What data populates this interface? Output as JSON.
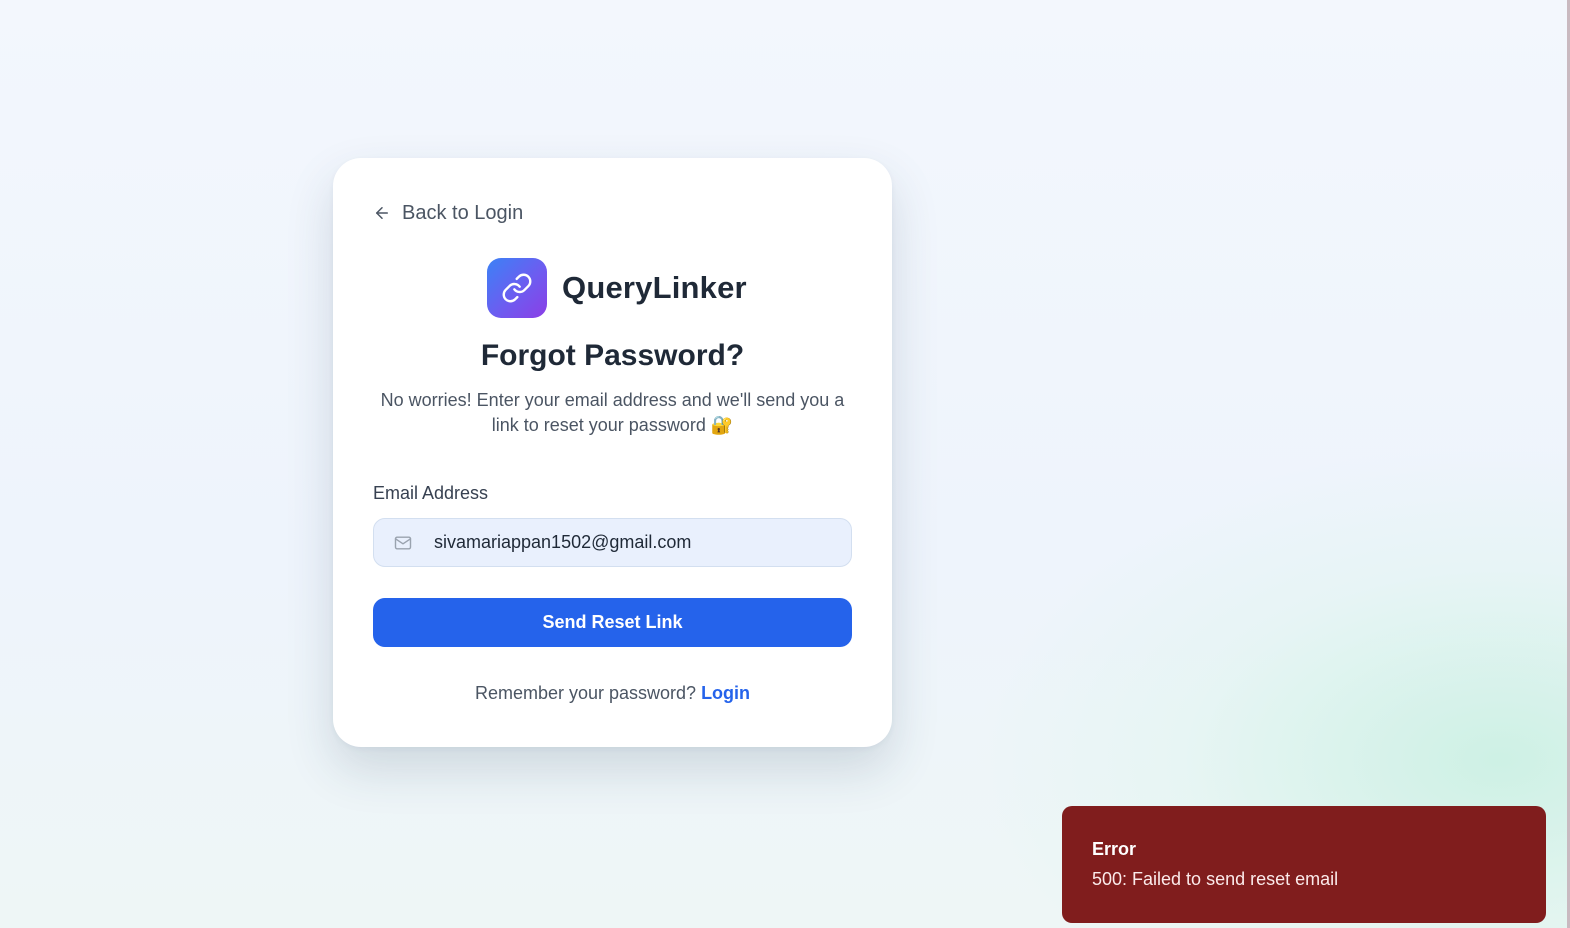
{
  "back_link": {
    "label": "Back to Login",
    "icon": "arrow-left-icon"
  },
  "brand": {
    "name": "QueryLinker",
    "logo_icon": "link-icon",
    "gradient": [
      "#3b82f6",
      "#8b3ee6"
    ]
  },
  "heading": {
    "title": "Forgot Password?",
    "subtitle": "No worries! Enter your email address and we'll send you a link to reset your password 🔐"
  },
  "form": {
    "email_label": "Email Address",
    "email_value": "sivamariappan1502@gmail.com",
    "email_icon": "mail-icon",
    "submit_label": "Send Reset Link"
  },
  "footer": {
    "prompt": "Remember your password?",
    "link_label": "Login"
  },
  "toast": {
    "title": "Error",
    "message": "500: Failed to send reset email",
    "color": "#801d1d"
  },
  "colors": {
    "accent": "#2563eb",
    "text_dark": "#1f2937",
    "text_muted": "#4b5563"
  }
}
